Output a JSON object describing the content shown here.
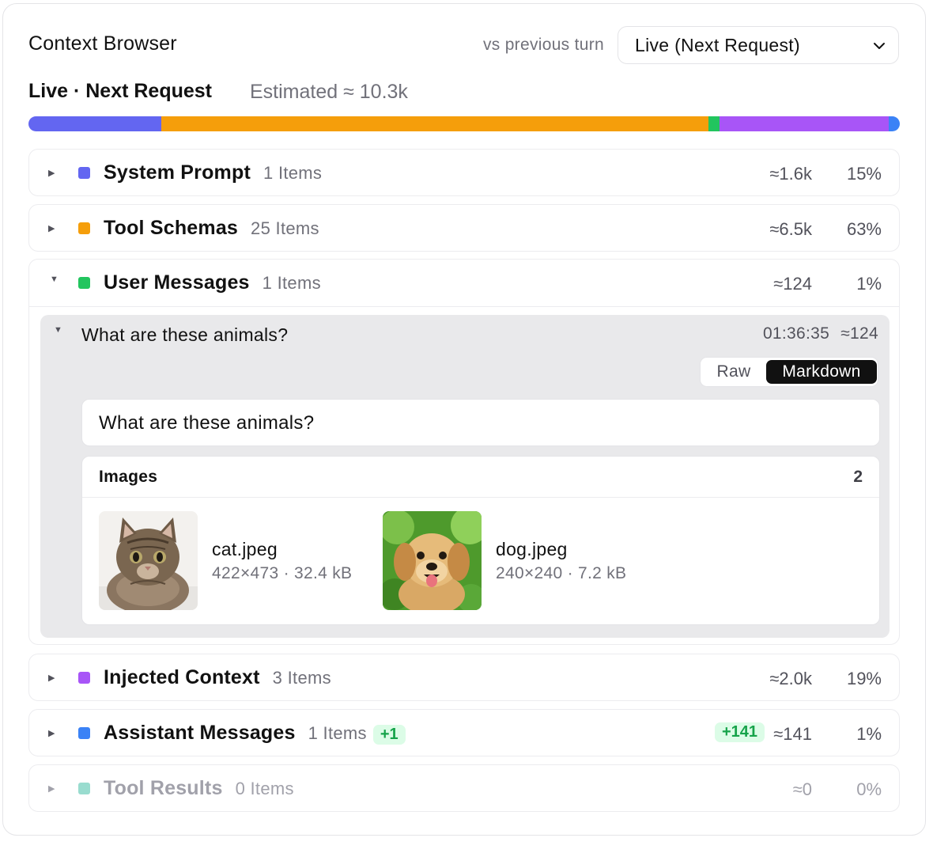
{
  "header": {
    "title": "Context Browser",
    "compare_label": "vs previous turn",
    "select_value": "Live (Next Request)",
    "select_icon": "chevron-down-icon"
  },
  "summary": {
    "title": "Live · Next Request",
    "estimate": "Estimated ≈ 10.3k"
  },
  "stack": [
    {
      "name": "System Prompt",
      "fraction": 0.152,
      "color": "#6366f1"
    },
    {
      "name": "Tool Schemas",
      "fraction": 0.628,
      "color": "#f59e0b"
    },
    {
      "name": "User Messages",
      "fraction": 0.013,
      "color": "#22c55e"
    },
    {
      "name": "Injected Context",
      "fraction": 0.194,
      "color": "#a855f7"
    },
    {
      "name": "Assistant Messages",
      "fraction": 0.013,
      "color": "#3b82f6"
    },
    {
      "name": "Tool Results",
      "fraction": 0.0,
      "color": "#99dccf"
    }
  ],
  "sections": {
    "system_prompt": {
      "name": "System Prompt",
      "count": "1 Items",
      "tokens": "≈1.6k",
      "pct": "15%",
      "color": "#6366f1"
    },
    "tool_schemas": {
      "name": "Tool Schemas",
      "count": "25 Items",
      "tokens": "≈6.5k",
      "pct": "63%",
      "color": "#f59e0b"
    },
    "user_messages": {
      "name": "User Messages",
      "count": "1 Items",
      "tokens": "≈124",
      "pct": "1%",
      "color": "#22c55e"
    },
    "injected_context": {
      "name": "Injected Context",
      "count": "3 Items",
      "tokens": "≈2.0k",
      "pct": "19%",
      "color": "#a855f7"
    },
    "assistant_messages": {
      "name": "Assistant Messages",
      "count": "1 Items",
      "badge": "+1",
      "delta": "+141",
      "tokens": "≈141",
      "pct": "1%",
      "color": "#3b82f6"
    },
    "tool_results": {
      "name": "Tool Results",
      "count": "0 Items",
      "tokens": "≈0",
      "pct": "0%",
      "color": "#99dccf"
    }
  },
  "message": {
    "title": "What are these animals?",
    "time": "01:36:35",
    "tokens": "≈124",
    "view_raw": "Raw",
    "view_markdown": "Markdown",
    "text": "What are these animals?",
    "images_label": "Images",
    "images_count": "2",
    "images": [
      {
        "name": "cat.jpeg",
        "meta": "422×473 · 32.4 kB"
      },
      {
        "name": "dog.jpeg",
        "meta": "240×240 · 7.2 kB"
      }
    ]
  }
}
